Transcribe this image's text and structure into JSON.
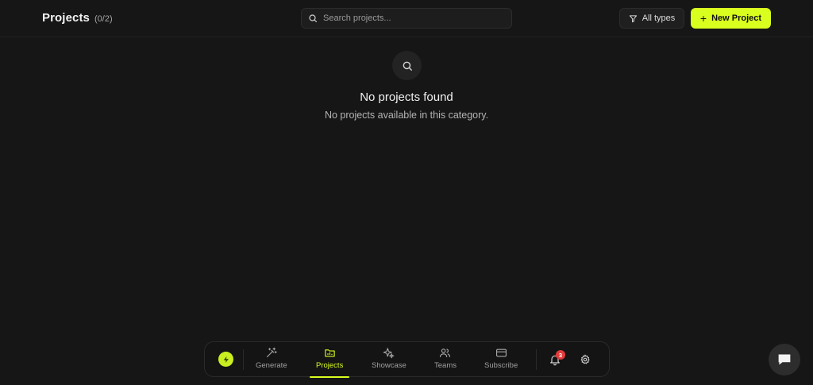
{
  "header": {
    "title": "Projects",
    "count": "(0/2)",
    "search_placeholder": "Search projects...",
    "filter_label": "All types",
    "new_project_label": "New Project"
  },
  "empty_state": {
    "title": "No projects found",
    "subtitle": "No projects available in this category."
  },
  "dock": {
    "items": [
      {
        "label": "Generate",
        "icon": "magic-wand-icon"
      },
      {
        "label": "Projects",
        "icon": "folder-icon",
        "active": true
      },
      {
        "label": "Showcase",
        "icon": "sparkles-icon"
      },
      {
        "label": "Teams",
        "icon": "users-icon"
      },
      {
        "label": "Subscribe",
        "icon": "credit-card-icon"
      }
    ],
    "notification_count": "3"
  },
  "colors": {
    "background": "#161616",
    "accent": "#d9ff1f",
    "badge": "#e23b3b"
  }
}
